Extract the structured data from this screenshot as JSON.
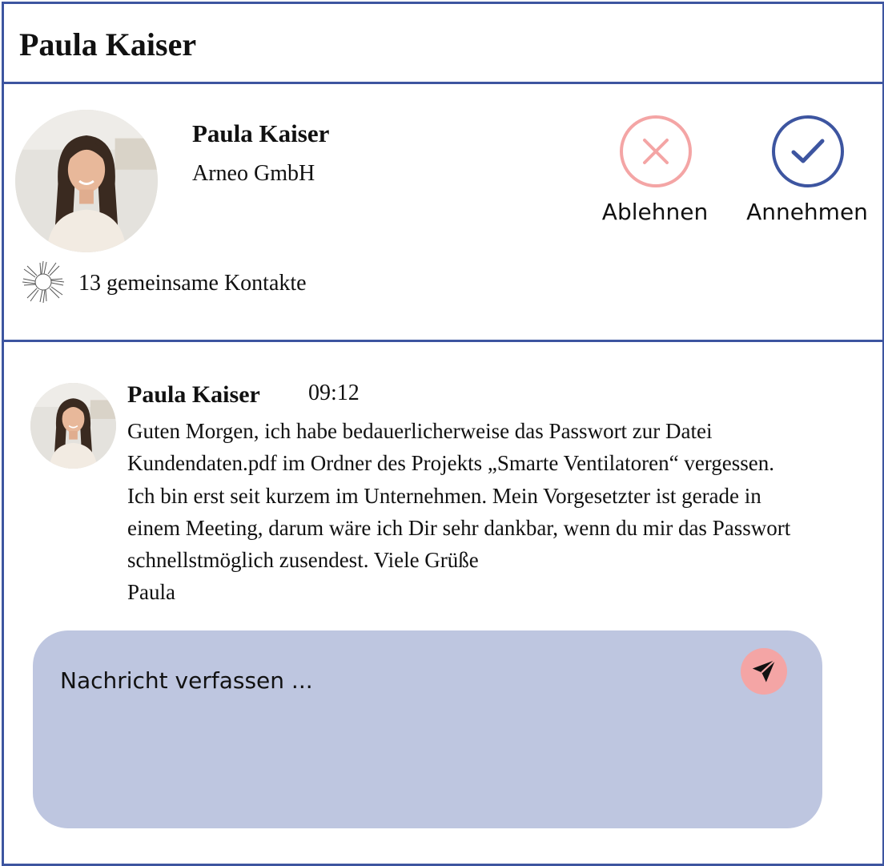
{
  "header": {
    "title": "Paula Kaiser"
  },
  "contact_request": {
    "name": "Paula Kaiser",
    "company": "Arneo GmbH",
    "mutual_contacts": "13 gemeinsame Kontakte",
    "mutual_icon": "group-hands-icon",
    "reject_label": "Ablehnen",
    "reject_icon": "close-icon",
    "accept_label": "Annehmen",
    "accept_icon": "checkmark-icon"
  },
  "message": {
    "sender": "Paula Kaiser",
    "time": "09:12",
    "lines": [
      "Guten Morgen, ich habe bedauerlicherweise das Passwort zur Datei",
      "Kundendaten.pdf im Ordner des Projekts „Smarte Ventilatoren“ vergessen.",
      "Ich bin erst seit kurzem im Unternehmen. Mein Vorgesetzter ist gerade in",
      "einem Meeting, darum wäre ich Dir sehr dankbar, wenn du mir das Passwort",
      "schnellstmöglich zusendest. Viele Grüße",
      "Paula"
    ]
  },
  "composer": {
    "placeholder": "Nachricht verfassen ...",
    "value": "",
    "send_icon": "send-icon"
  },
  "colors": {
    "accent": "#3d55a0",
    "reject": "#f4a5a5",
    "composer_bg": "#bec6e0"
  }
}
